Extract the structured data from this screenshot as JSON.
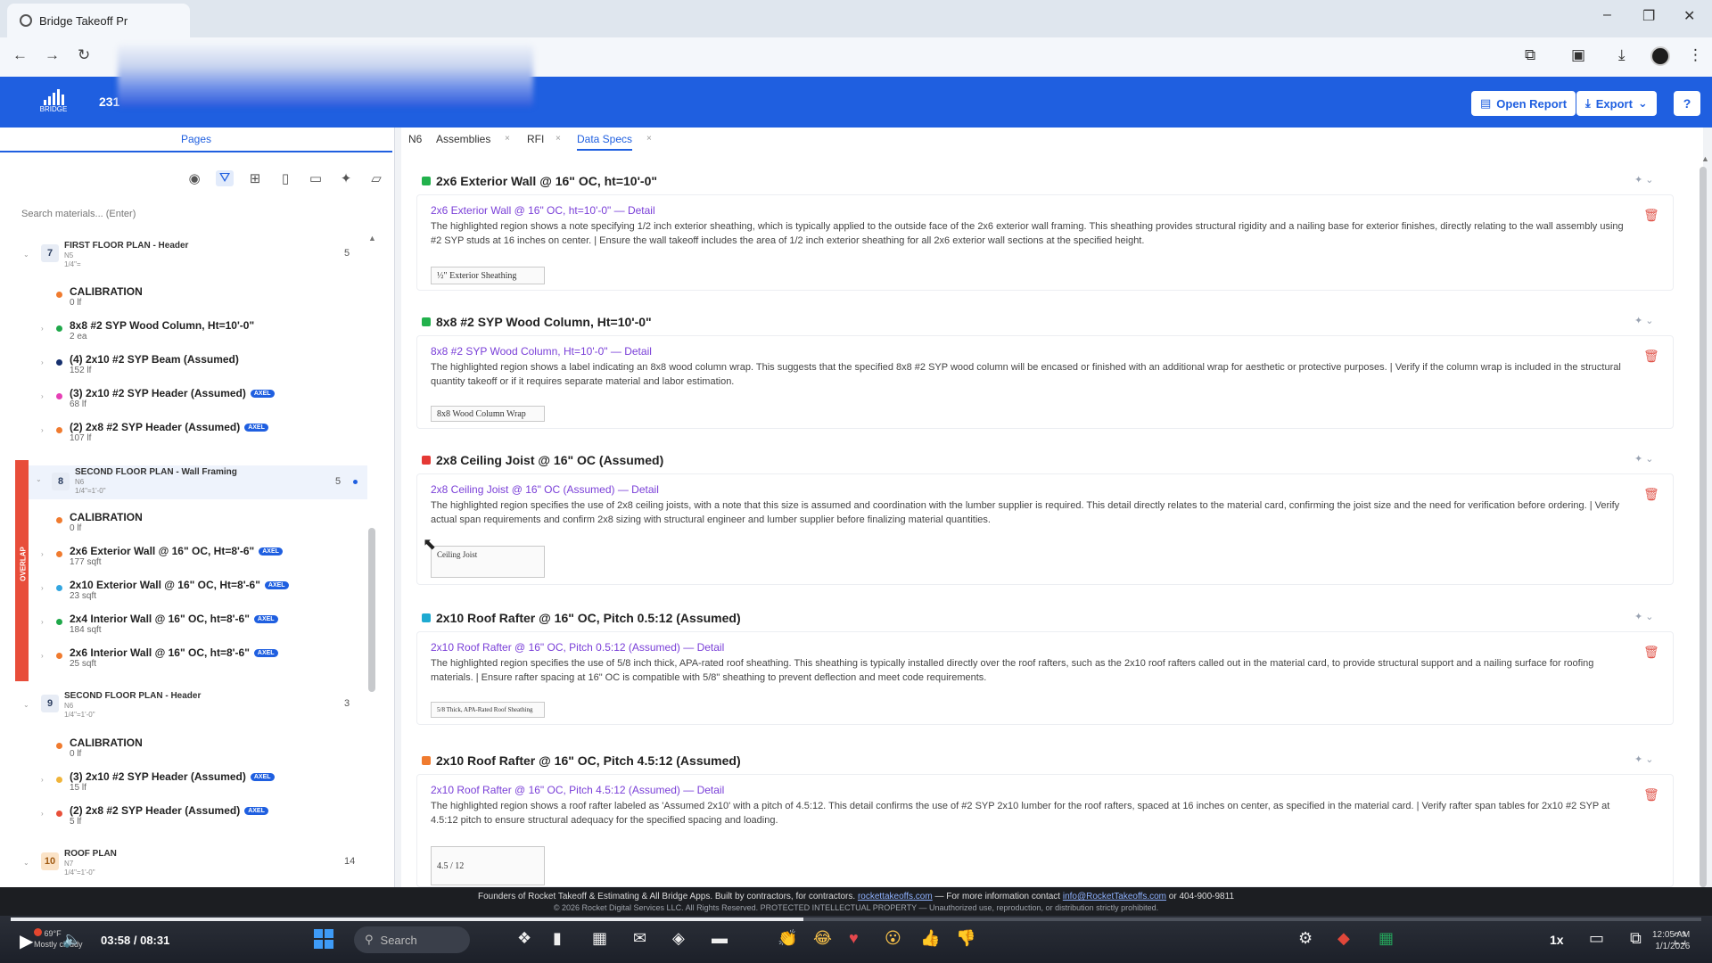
{
  "browser": {
    "tab_title": "Bridge Takeoff Pr",
    "window_controls": [
      "–",
      "❐",
      "✕"
    ]
  },
  "header": {
    "logo_text": "BRIDGE",
    "project_number": "231",
    "open_report_label": "Open Report",
    "export_label": "Export",
    "help_label": "?",
    "accent": "#1f5fe0"
  },
  "left": {
    "pages_tab": "Pages",
    "search_placeholder": "Search materials... (Enter)",
    "overlap_label": "OVERLAP",
    "pages": [
      {
        "num": "7",
        "title": "FIRST FLOOR PLAN - Header",
        "sheet": "N5",
        "scale": "1/4\"=",
        "count": "5",
        "materials": [
          {
            "name": "CALIBRATION",
            "qty": "0 lf",
            "color": "#f07b2f",
            "badge": ""
          },
          {
            "name": "8x8 #2 SYP Wood Column, Ht=10'-0\"",
            "qty": "2 ea",
            "color": "#1fa84a",
            "badge": ""
          },
          {
            "name": "(4) 2x10 #2 SYP Beam (Assumed)",
            "qty": "152 lf",
            "color": "#16306e",
            "badge": ""
          },
          {
            "name": "(3) 2x10 #2 SYP Header (Assumed)",
            "qty": "68 lf",
            "color": "#e63fb5",
            "badge": "AXEL"
          },
          {
            "name": "(2) 2x8 #2 SYP Header (Assumed)",
            "qty": "107 lf",
            "color": "#f07b2f",
            "badge": "AXEL"
          }
        ]
      },
      {
        "num": "8",
        "title": "SECOND FLOOR PLAN - Wall Framing",
        "sheet": "N6",
        "scale": "1/4\"=1'-0\"",
        "count": "5",
        "materials": [
          {
            "name": "CALIBRATION",
            "qty": "0 lf",
            "color": "#f07b2f",
            "badge": ""
          },
          {
            "name": "2x6 Exterior Wall @ 16\" OC, Ht=8'-6\"",
            "qty": "177 sqft",
            "color": "#f07b2f",
            "badge": "AXEL"
          },
          {
            "name": "2x10 Exterior Wall @ 16\" OC, Ht=8'-6\"",
            "qty": "23 sqft",
            "color": "#33a6e0",
            "badge": "AXEL"
          },
          {
            "name": "2x4 Interior Wall @ 16\" OC, ht=8'-6\"",
            "qty": "184 sqft",
            "color": "#1fa84a",
            "badge": "AXEL"
          },
          {
            "name": "2x6 Interior Wall @ 16\" OC, ht=8'-6\"",
            "qty": "25 sqft",
            "color": "#f07b2f",
            "badge": "AXEL"
          }
        ]
      },
      {
        "num": "9",
        "title": "SECOND FLOOR PLAN - Header",
        "sheet": "N6",
        "scale": "1/4\"=1'-0\"",
        "count": "3",
        "materials": [
          {
            "name": "CALIBRATION",
            "qty": "0 lf",
            "color": "#f07b2f",
            "badge": ""
          },
          {
            "name": "(3) 2x10 #2 SYP Header (Assumed)",
            "qty": "15 lf",
            "color": "#f0b43a",
            "badge": "AXEL"
          },
          {
            "name": "(2) 2x8 #2 SYP Header (Assumed)",
            "qty": "5 lf",
            "color": "#e8503a",
            "badge": "AXEL"
          }
        ]
      },
      {
        "num": "10",
        "title": "ROOF PLAN",
        "sheet": "N7",
        "scale": "1/4\"=1'-0\"",
        "count": "14",
        "materials": []
      }
    ]
  },
  "right": {
    "tabs": [
      {
        "label": "N6"
      },
      {
        "label": "Assemblies"
      },
      {
        "label": "RFI"
      },
      {
        "label": "Data Specs"
      }
    ],
    "cards": [
      {
        "title": "2x6 Exterior Wall @ 16\" OC, ht=10'-0\"",
        "color": "#22b14c",
        "detail_title": "2x6 Exterior Wall @ 16\" OC, ht=10'-0\" — Detail",
        "detail_text": "The highlighted region shows a note specifying 1/2 inch exterior sheathing, which is typically applied to the outside face of the 2x6 exterior wall framing. This sheathing provides structural rigidity and a nailing base for exterior finishes, directly relating to the wall assembly using #2 SYP studs at 16 inches on center. | Ensure the wall takeoff includes the area of 1/2 inch exterior sheathing for all 2x6 exterior wall sections at the specified height.",
        "thumb": "½\" Exterior Sheathing"
      },
      {
        "title": "8x8 #2 SYP Wood Column, Ht=10'-0\"",
        "color": "#22b14c",
        "detail_title": "8x8 #2 SYP Wood Column, Ht=10'-0\" — Detail",
        "detail_text": "The highlighted region shows a label indicating an 8x8 wood column wrap. This suggests that the specified 8x8 #2 SYP wood column will be encased or finished with an additional wrap for aesthetic or protective purposes. | Verify if the column wrap is included in the structural quantity takeoff or if it requires separate material and labor estimation.",
        "thumb": "8x8 Wood Column Wrap"
      },
      {
        "title": "2x8 Ceiling Joist @ 16\" OC (Assumed)",
        "color": "#e53935",
        "detail_title": "2x8 Ceiling Joist @ 16\" OC (Assumed) — Detail",
        "detail_text": "The highlighted region specifies the use of 2x8 ceiling joists, with a note that this size is assumed and coordination with the lumber supplier is required. This detail directly relates to the material card, confirming the joist size and the need for verification before ordering. | Verify actual span requirements and confirm 2x8 sizing with structural engineer and lumber supplier before finalizing material quantities.",
        "thumb": "Ceiling Joist"
      },
      {
        "title": "2x10 Roof Rafter @ 16\" OC, Pitch 0.5:12 (Assumed)",
        "color": "#1eaad1",
        "detail_title": "2x10 Roof Rafter @ 16\" OC, Pitch 0.5:12 (Assumed) — Detail",
        "detail_text": "The highlighted region specifies the use of 5/8 inch thick, APA-rated roof sheathing. This sheathing is typically installed directly over the roof rafters, such as the 2x10 roof rafters called out in the material card, to provide structural support and a nailing surface for roofing materials. | Ensure rafter spacing at 16\" OC is compatible with 5/8\" sheathing to prevent deflection and meet code requirements.",
        "thumb": "5/8 Thick, APA-Rated Roof Sheathing"
      },
      {
        "title": "2x10 Roof Rafter @ 16\" OC, Pitch 4.5:12 (Assumed)",
        "color": "#f07b2f",
        "detail_title": "2x10 Roof Rafter @ 16\" OC, Pitch 4.5:12 (Assumed) — Detail",
        "detail_text": "The highlighted region shows a roof rafter labeled as 'Assumed 2x10' with a pitch of 4.5:12. This detail confirms the use of #2 SYP 2x10 lumber for the roof rafters, spaced at 16 inches on center, as specified in the material card. | Verify rafter span tables for 2x10 #2 SYP at 4.5:12 pitch to ensure structural adequacy for the specified spacing and loading.",
        "thumb": "4.5 / 12"
      }
    ]
  },
  "footer": {
    "line1_prefix": "Founders of Rocket Takeoff & Estimating & All Bridge Apps. Built by contractors, for contractors.",
    "line1_link": "rockettakeoffs.com",
    "line1_mid": "— For more information contact",
    "line1_email": "info@RocketTakeoffs.com",
    "line1_suffix": "or 404-900-9811",
    "line2": "© 2026 Rocket Digital Services LLC. All Rights Reserved. PROTECTED INTELLECTUAL PROPERTY — Unauthorized use, reproduction, or distribution strictly prohibited."
  },
  "player": {
    "time": "03:58 / 08:31",
    "progress": 0.469,
    "speed": "1x",
    "weather_temp": "69°F",
    "weather_desc": "Mostly cloudy",
    "search_label": "Search",
    "clock_time": "12:05 AM",
    "clock_date": "1/1/2026"
  }
}
